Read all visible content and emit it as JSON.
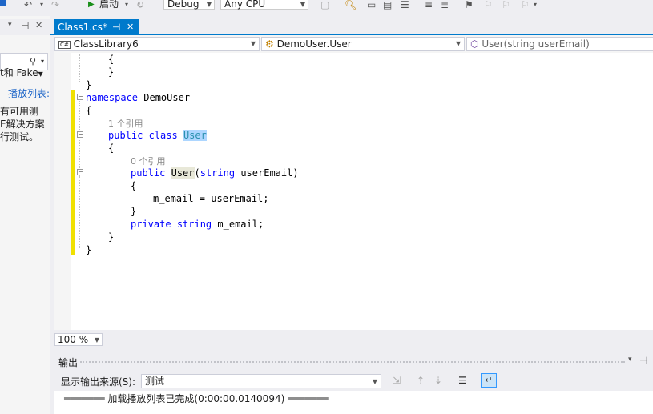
{
  "toolbar": {
    "start_label": "启动",
    "config": "Debug",
    "platform": "Any CPU"
  },
  "left_panel": {
    "line1": "t和 Fake",
    "line2": "播放列表:",
    "desc1": "有可用测",
    "desc2": "E解决方案",
    "desc3": "行测试。"
  },
  "tab": {
    "title": "Class1.cs*",
    "pin_glyph": "⊣",
    "close_glyph": "✕"
  },
  "navbar": {
    "project": "ClassLibrary6",
    "project_icon_text": "C#",
    "type": "DemoUser.User",
    "member": "User(string userEmail)"
  },
  "code": {
    "ref1": "1 个引用",
    "ref0": "0 个引用"
  },
  "zoom": "100 %",
  "output": {
    "title": "输出",
    "source_label": "显示输出来源(S):",
    "source_value": "测试",
    "message": "═══════ 加载播放列表已完成(0:00:00.0140094) ═══════"
  }
}
